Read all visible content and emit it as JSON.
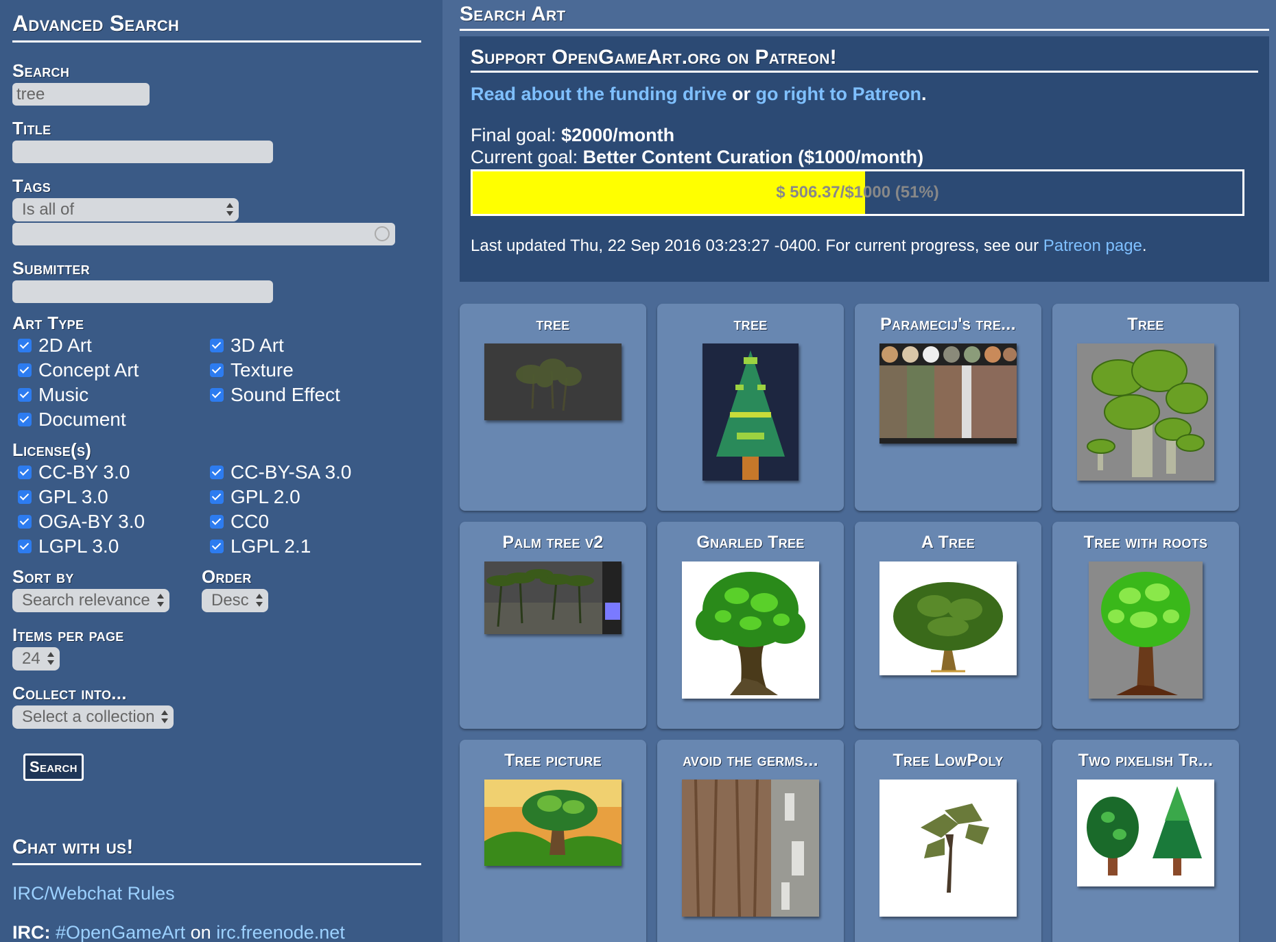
{
  "sidebar": {
    "title": "Advanced Search",
    "search": {
      "label": "Search",
      "value": "tree"
    },
    "title_field": {
      "label": "Title",
      "value": ""
    },
    "tags": {
      "label": "Tags",
      "operator": "Is all of",
      "value": ""
    },
    "submitter": {
      "label": "Submitter",
      "value": ""
    },
    "art_type": {
      "label": "Art Type",
      "options": [
        "2D Art",
        "3D Art",
        "Concept Art",
        "Texture",
        "Music",
        "Sound Effect",
        "Document"
      ]
    },
    "licenses": {
      "label": "License(s)",
      "options": [
        "CC-BY 3.0",
        "CC-BY-SA 3.0",
        "GPL 3.0",
        "GPL 2.0",
        "OGA-BY 3.0",
        "CC0",
        "LGPL 3.0",
        "LGPL 2.1"
      ]
    },
    "sort_by": {
      "label": "Sort by",
      "value": "Search relevance"
    },
    "order": {
      "label": "Order",
      "value": "Desc"
    },
    "items_per_page": {
      "label": "Items per page",
      "value": "24"
    },
    "collect_into": {
      "label": "Collect into...",
      "value": "Select a collection"
    },
    "search_button": "Search",
    "chat": {
      "title": "Chat with us!",
      "rules_link": "IRC/Webchat Rules",
      "irc_label": "IRC:",
      "channel": "#OpenGameArt",
      "on": "on",
      "server": "irc.freenode.net"
    }
  },
  "main": {
    "title": "Search Art",
    "patreon": {
      "title": "Support OpenGameArt.org on Patreon!",
      "link1": "Read about the funding drive",
      "or": "or",
      "link2": "go right to Patreon",
      "period": ".",
      "final_goal_label": "Final goal:",
      "final_goal_value": "$2000/month",
      "current_goal_label": "Current goal:",
      "current_goal_value": "Better Content Curation ($1000/month)",
      "progress_text": "$ 506.37/$1000 (51%)",
      "progress_fraction": 0.51,
      "updated_text": "Last updated Thu, 22 Sep 2016 03:23:27 -0400. For current progress, see our",
      "updated_link": "Patreon page",
      "updated_period": "."
    },
    "results": [
      {
        "title": "tree",
        "thumb": "tree-silhouette"
      },
      {
        "title": "tree",
        "thumb": "pixel-pine"
      },
      {
        "title": "Paramecij's tre...",
        "thumb": "bark-textures"
      },
      {
        "title": "Tree",
        "thumb": "cartoon-trees"
      },
      {
        "title": "Palm tree v2",
        "thumb": "palm-scene"
      },
      {
        "title": "Gnarled Tree",
        "thumb": "gnarled-tree"
      },
      {
        "title": "A Tree",
        "thumb": "round-tree"
      },
      {
        "title": "Tree with roots",
        "thumb": "tree-roots"
      },
      {
        "title": "Tree picture",
        "thumb": "painted-tree"
      },
      {
        "title": "avoid the germs...",
        "thumb": "bark-texture"
      },
      {
        "title": "Tree LowPoly",
        "thumb": "lowpoly-tree"
      },
      {
        "title": "Two pixelish Tr...",
        "thumb": "two-pixel-trees"
      }
    ]
  },
  "colors": {
    "sidebar_bg": "#3a5a86",
    "page_bg": "#4b6a96",
    "card_bg": "#6887b1",
    "link": "#9cd1ff",
    "progress": "#ffff00",
    "checkbox": "#2d7cf0"
  }
}
